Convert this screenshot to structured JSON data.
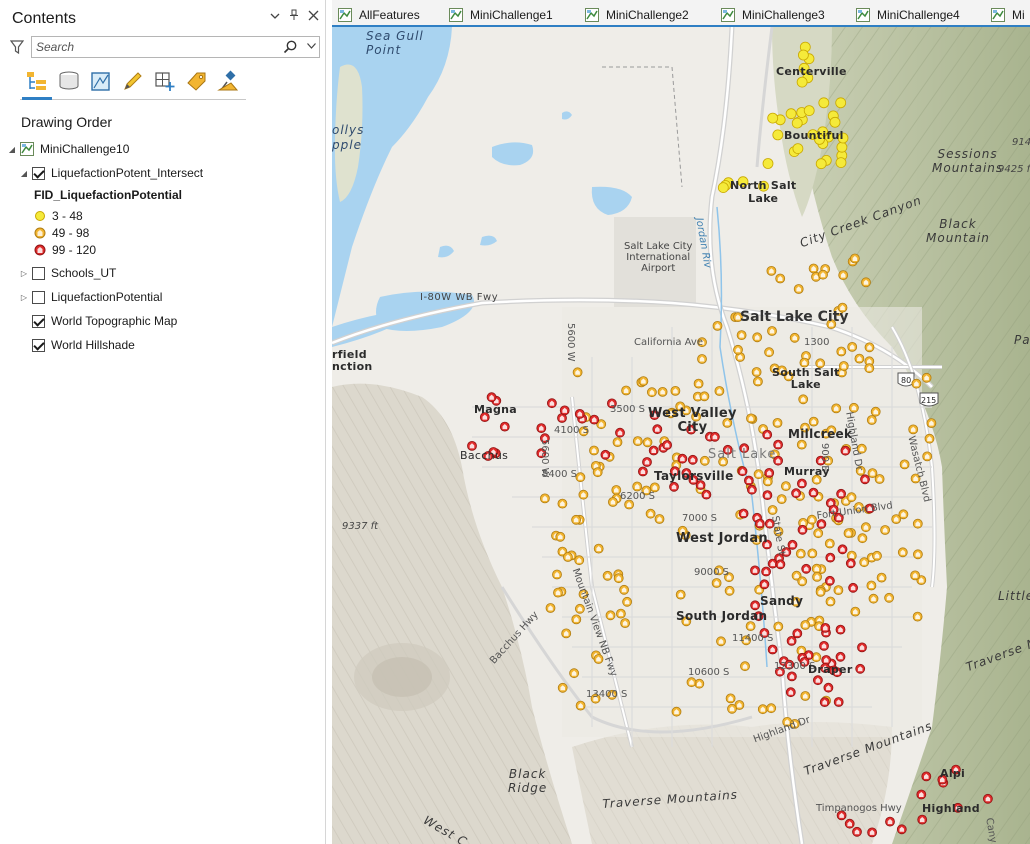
{
  "contents": {
    "title": "Contents",
    "header_icons": [
      "chevron-down-icon",
      "pin-icon",
      "close-icon"
    ],
    "search_placeholder": "Search",
    "toolbar_icons": [
      "list-by-drawing-order-icon",
      "list-by-source-icon",
      "list-by-selection-icon",
      "list-by-editing-icon",
      "list-by-snapping-icon",
      "list-by-labeling-icon",
      "list-by-perspective-imagery-icon"
    ],
    "section_title": "Drawing Order",
    "map_name": "MiniChallenge10",
    "layers": [
      {
        "name": "LiquefactionPotent_Intersect",
        "checked": true,
        "expanded": true
      },
      {
        "name": "Schools_UT",
        "checked": false,
        "expanded": false
      },
      {
        "name": "LiquefactionPotential",
        "checked": false,
        "expanded": false
      },
      {
        "name": "World Topographic Map",
        "checked": true
      },
      {
        "name": "World Hillshade",
        "checked": true
      }
    ],
    "legend": {
      "field": "FID_LiquefactionPotential",
      "classes": [
        {
          "label": "3 - 48",
          "color": "#f5ea3a"
        },
        {
          "label": "49 - 98",
          "color": "#f2b531"
        },
        {
          "label": "99 - 120",
          "color": "#e02b2b"
        }
      ]
    }
  },
  "map_tabs": [
    {
      "label": "AllFeatures"
    },
    {
      "label": "MiniChallenge1"
    },
    {
      "label": "MiniChallenge2"
    },
    {
      "label": "MiniChallenge3"
    },
    {
      "label": "MiniChallenge4"
    },
    {
      "label": "Mi"
    }
  ],
  "map": {
    "labels": {
      "sea_gull_point": "Sea Gull\nPoint",
      "rollys_apple": "ollys\npple",
      "centerville": "Centerville",
      "bountiful": "Bountiful",
      "north_salt_lake": "North Salt\nLake",
      "sessions_mountains": "Sessions\nMountains",
      "elev_9425": "9425 ft",
      "elev_914": "914",
      "black_mountain": "Black\nMountain",
      "city_creek_canyon": "City Creek Canyon",
      "jordan_river": "Jordan Riv",
      "airport": "Salt Lake City\nInternational\nAirport",
      "i80": "I-80W WB Fwy",
      "salt_lake_city": "Salt Lake City",
      "fairfield": "rfield\nnction",
      "5600w": "5600 W",
      "california_ave": "California Ave",
      "south_salt_lake": "South Salt\nLake",
      "1300": "1300",
      "magna": "Magna",
      "west_valley": "West Valley\nCity",
      "3500s": "3500 S",
      "4100s": "4100 S",
      "5600w_2": "5600 W",
      "millcreek": "Millcreek",
      "bacchus": "Bacchus",
      "5400s": "5400 S",
      "salt_lake_muted": "Salt Lake",
      "taylorsville": "Taylorsville",
      "murray": "Murray",
      "6200s": "6200 S",
      "elev_9337": "9337 ft",
      "7000s": "7000 S",
      "fort_union": "Fort Union Blvd",
      "west_jordan": "West Jordan",
      "state_st": "State St",
      "9000s": "9000 S",
      "sandy": "Sandy",
      "wasatch_blvd": "Wasatch Blvd",
      "highland_dr": "Highland Dr",
      "900e": "900 E",
      "little": "Little",
      "south_jordan": "South Jordan",
      "11400s": "11400 S",
      "bacchus_hwy": "Bacchus Hwy",
      "mountain_view": "Mountain View NB Fwy",
      "10600s": "10600 S",
      "12300s": "12300 S",
      "draper": "Draper",
      "13400s": "13400 S",
      "traverse_mountains": "Traverse Mountains",
      "traverse_mountains_2": "Traverse Mountains",
      "traverse_mountains_3": "Traverse M",
      "highland_dr_2": "Highland Dr",
      "black_ridge": "Black\nRidge",
      "west_c": "West C",
      "timpanogos": "Timpanogos Hwy",
      "highland": "Highland",
      "alpine": "Alpi",
      "canyon": "Cany",
      "pa": "Pa",
      "80": "80",
      "215": "215"
    }
  }
}
